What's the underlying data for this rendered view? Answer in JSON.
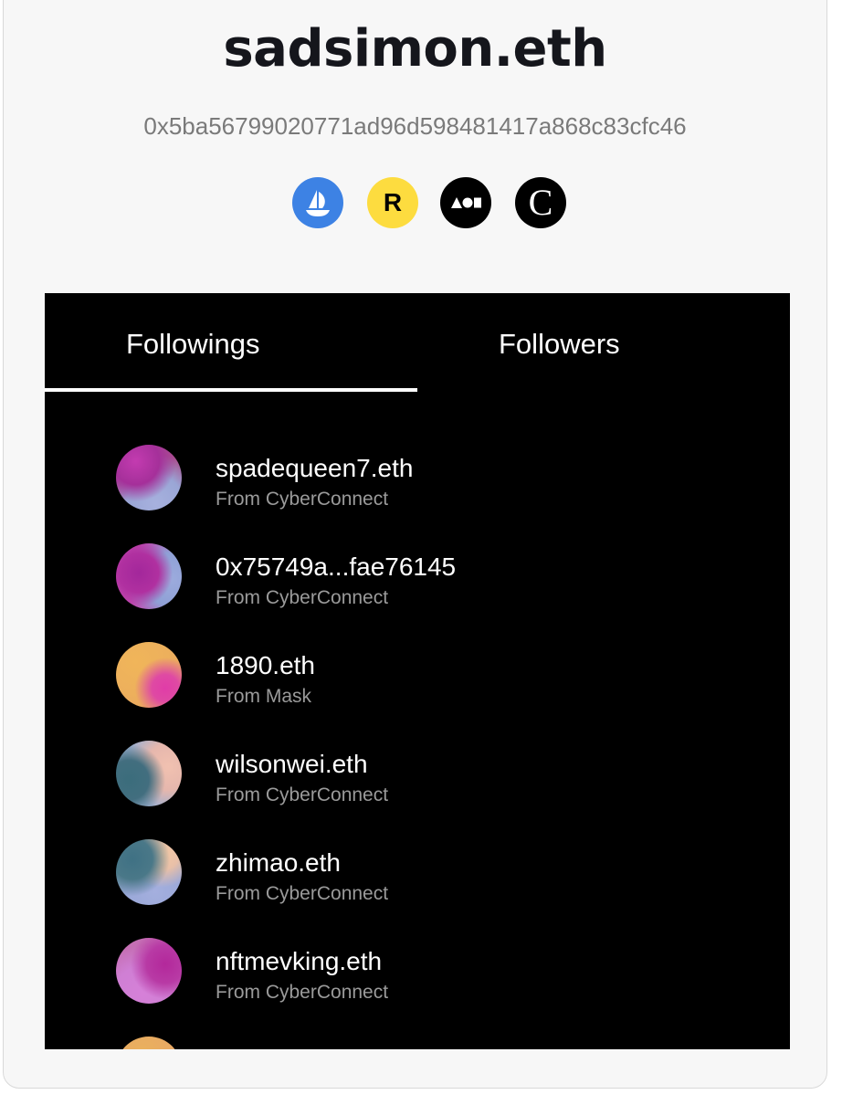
{
  "profile": {
    "name": "sadsimon.eth",
    "address": "0x5ba56799020771ad96d598481417a868c83cfc46"
  },
  "links": [
    {
      "icon": "opensea-icon",
      "color": "#3d82e4"
    },
    {
      "icon": "rarible-icon",
      "color": "#fddc3f",
      "glyph": "R"
    },
    {
      "icon": "foundation-icon",
      "color": "#000000"
    },
    {
      "icon": "context-icon",
      "color": "#000000",
      "glyph": "C"
    }
  ],
  "tabs": {
    "followings": "Followings",
    "followers": "Followers",
    "active": "followings"
  },
  "followings": [
    {
      "name": "spadequeen7.eth",
      "source": "From CyberConnect"
    },
    {
      "name": "0x75749a...fae76145",
      "source": "From CyberConnect"
    },
    {
      "name": "1890.eth",
      "source": "From Mask"
    },
    {
      "name": "wilsonwei.eth",
      "source": "From CyberConnect"
    },
    {
      "name": "zhimao.eth",
      "source": "From CyberConnect"
    },
    {
      "name": "nftmevking.eth",
      "source": "From CyberConnect"
    },
    {
      "name": "",
      "source": ""
    }
  ]
}
